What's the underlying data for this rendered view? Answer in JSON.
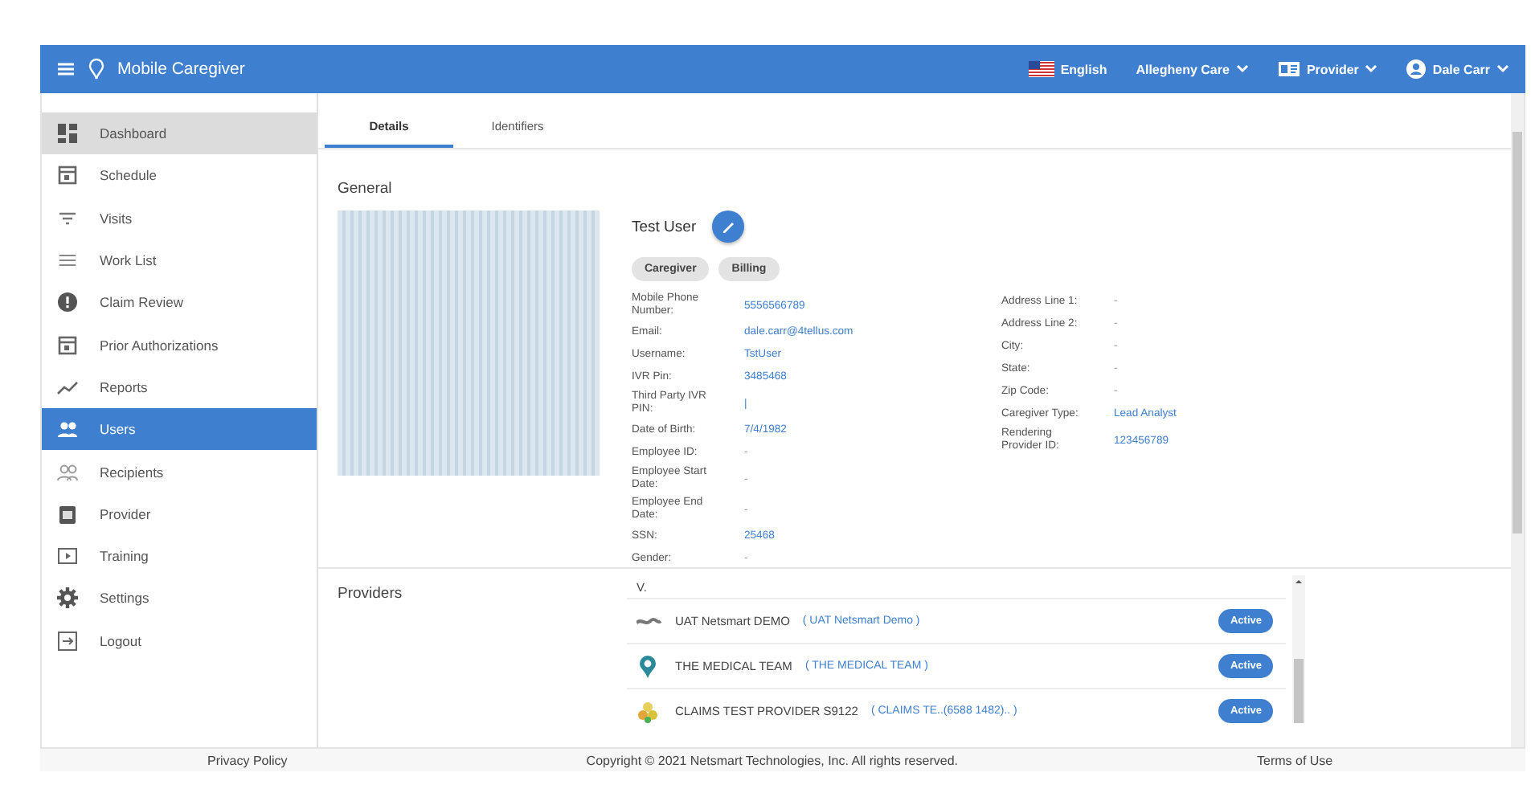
{
  "topbar": {
    "app_name": "Mobile Caregiver",
    "language": "English",
    "agency": "Allegheny Care",
    "role": "Provider",
    "user": "Dale Carr"
  },
  "sidebar": {
    "items": [
      {
        "label": "Dashboard",
        "kind": "dashboard",
        "selected": false,
        "highlighted": true
      },
      {
        "label": "Schedule",
        "kind": "calendar",
        "selected": false,
        "highlighted": false
      },
      {
        "label": "Visits",
        "kind": "filter",
        "selected": false,
        "highlighted": false
      },
      {
        "label": "Work List",
        "kind": "list",
        "selected": false,
        "highlighted": false
      },
      {
        "label": "Claim Review",
        "kind": "alert",
        "selected": false,
        "highlighted": false
      },
      {
        "label": "Prior Authorizations",
        "kind": "calendar",
        "selected": false,
        "highlighted": false
      },
      {
        "label": "Reports",
        "kind": "chart",
        "selected": false,
        "highlighted": false
      },
      {
        "label": "Users",
        "kind": "people",
        "selected": true,
        "highlighted": false
      },
      {
        "label": "Recipients",
        "kind": "people-outline",
        "selected": false,
        "highlighted": false
      },
      {
        "label": "Provider",
        "kind": "clipboard",
        "selected": false,
        "highlighted": false
      },
      {
        "label": "Training",
        "kind": "screen",
        "selected": false,
        "highlighted": false
      },
      {
        "label": "Settings",
        "kind": "gear",
        "selected": false,
        "highlighted": false
      },
      {
        "label": "Logout",
        "kind": "logout",
        "selected": false,
        "highlighted": false
      }
    ]
  },
  "tabs": [
    {
      "label": "Details",
      "selected": true
    },
    {
      "label": "Identifiers",
      "selected": false
    }
  ],
  "general": {
    "title": "General",
    "name": "Test User",
    "roles": [
      "Caregiver",
      "Billing"
    ],
    "fields_left": [
      {
        "label": "Mobile Phone Number:",
        "value": "5556566789",
        "kind": "value"
      },
      {
        "label": "Email:",
        "value": "dale.carr@4tellus.com",
        "kind": "value"
      },
      {
        "label": "Username:",
        "value": "TstUser",
        "kind": "value"
      },
      {
        "label": "IVR Pin:",
        "value": "3485468",
        "kind": "value"
      },
      {
        "label": "Third Party IVR PIN:",
        "value": "|",
        "kind": "value"
      },
      {
        "label": "Date of Birth:",
        "value": "7/4/1982",
        "kind": "value"
      },
      {
        "label": "Employee ID:",
        "value": "-",
        "kind": "empty"
      },
      {
        "label": "Employee Start Date:",
        "value": "-",
        "kind": "empty"
      },
      {
        "label": "Employee End Date:",
        "value": "-",
        "kind": "empty"
      },
      {
        "label": "SSN:",
        "value": "25468",
        "kind": "value"
      },
      {
        "label": "Gender:",
        "value": "-",
        "kind": "empty"
      }
    ],
    "fields_right": [
      {
        "label": "Address Line 1:",
        "value": "-",
        "kind": "empty"
      },
      {
        "label": "Address Line 2:",
        "value": "-",
        "kind": "empty"
      },
      {
        "label": "City:",
        "value": "-",
        "kind": "empty"
      },
      {
        "label": "State:",
        "value": "-",
        "kind": "empty"
      },
      {
        "label": "Zip Code:",
        "value": "-",
        "kind": "empty"
      },
      {
        "label": "Caregiver Type:",
        "value": "Lead Analyst",
        "kind": "value"
      },
      {
        "label": "Rendering Provider ID:",
        "value": "123456789",
        "kind": "value"
      }
    ]
  },
  "providers": {
    "title": "Providers",
    "rows": [
      {
        "kind": "partial",
        "name": "V."
      },
      {
        "kind": "scribble",
        "name": "UAT Netsmart DEMO",
        "code": "( UAT Netsmart Demo )",
        "status": "Active"
      },
      {
        "kind": "pin",
        "name": "THE MEDICAL TEAM",
        "code": "( THE MEDICAL TEAM )",
        "status": "Active"
      },
      {
        "kind": "balloons",
        "name": "CLAIMS TEST PROVIDER S9122",
        "code": "( CLAIMS TE..(6588 1482).. )",
        "status": "Active"
      }
    ]
  },
  "footer": {
    "privacy": "Privacy Policy",
    "copyright": "Copyright © 2021 Netsmart Technologies, Inc. All rights reserved.",
    "terms": "Terms of Use"
  }
}
